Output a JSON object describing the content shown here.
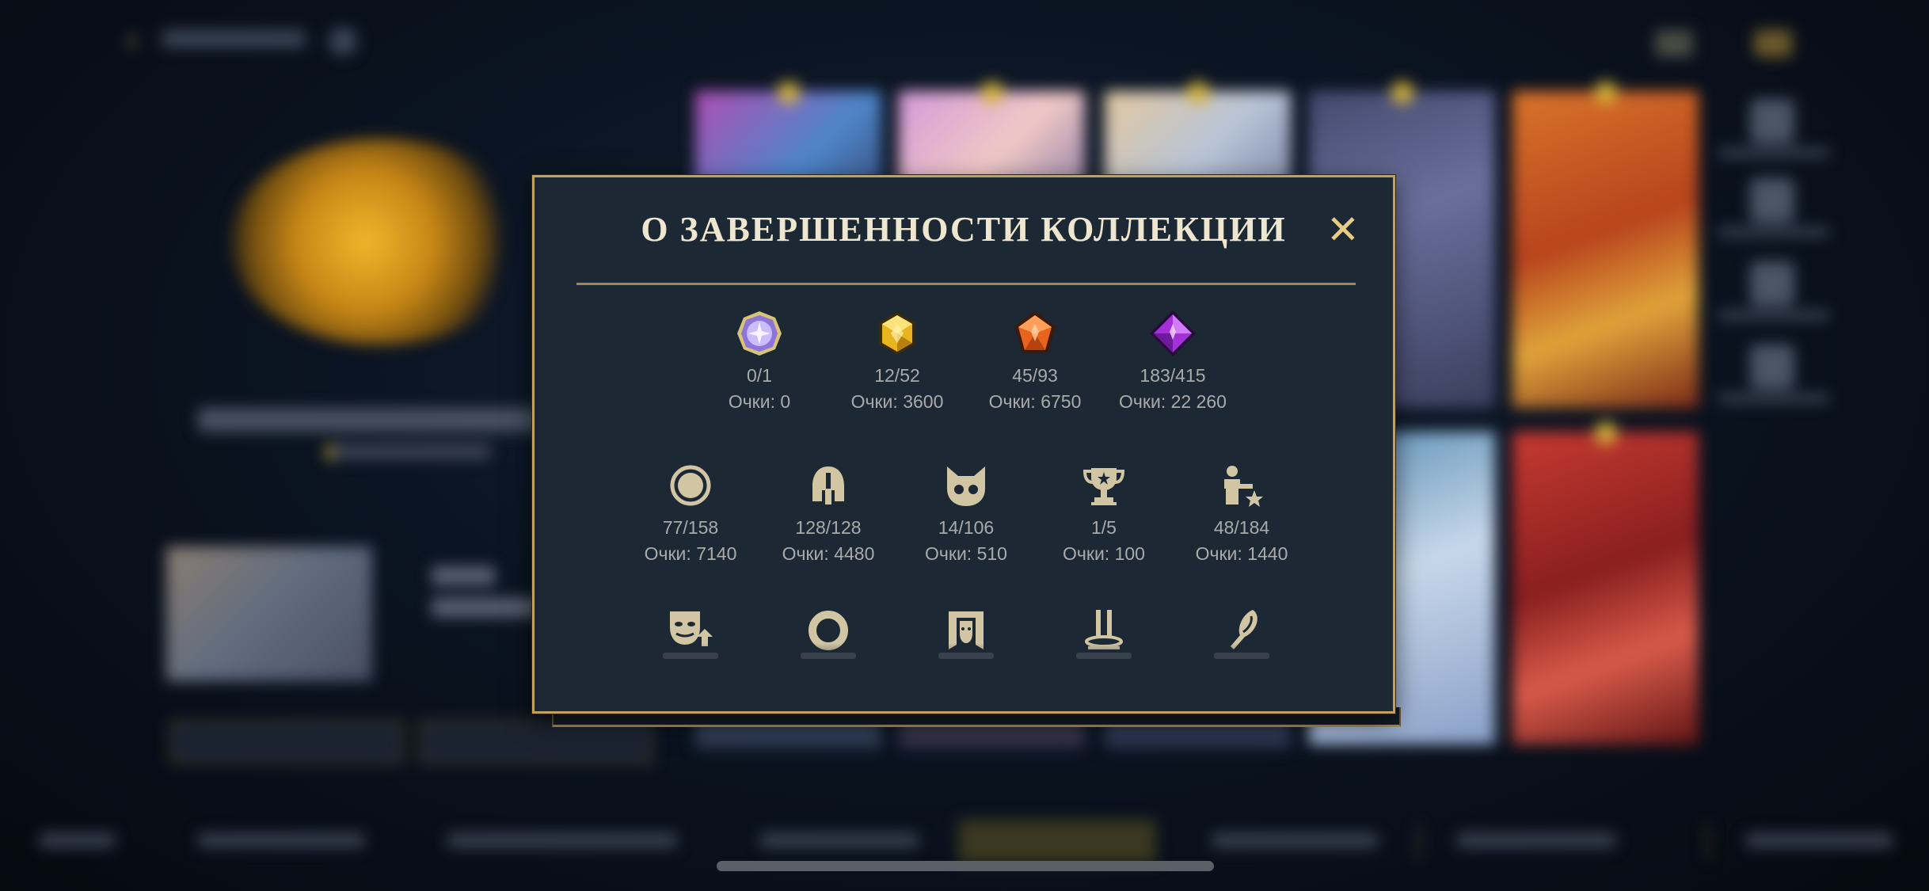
{
  "modal": {
    "title": "О ЗАВЕРШЕННОСТИ КОЛЛЕКЦИИ",
    "close_glyph": "✕"
  },
  "stats_row1": [
    {
      "icon": "ultimate-gem-icon",
      "color": "#b9a8ff",
      "count": "0/1",
      "points": "Очки: 0"
    },
    {
      "icon": "legendary-gem-icon",
      "color": "#e9b51e",
      "count": "12/52",
      "points": "Очки: 3600"
    },
    {
      "icon": "mythic-gem-icon",
      "color": "#e8641c",
      "count": "45/93",
      "points": "Очки: 6750"
    },
    {
      "icon": "epic-gem-icon",
      "color": "#a431d8",
      "count": "183/415",
      "points": "Очки: 22 260"
    }
  ],
  "stats_row2": [
    {
      "icon": "circle-token-icon",
      "count": "77/158",
      "points": "Очки: 7140"
    },
    {
      "icon": "helmet-icon",
      "count": "128/128",
      "points": "Очки: 4480"
    },
    {
      "icon": "cat-face-icon",
      "count": "14/106",
      "points": "Очки: 510"
    },
    {
      "icon": "trophy-icon",
      "count": "1/5",
      "points": "Очки: 100"
    },
    {
      "icon": "person-star-icon",
      "count": "48/184",
      "points": "Очки: 1440"
    }
  ],
  "stats_row3": [
    {
      "icon": "masks-icon"
    },
    {
      "icon": "ring-icon"
    },
    {
      "icon": "banner-face-icon"
    },
    {
      "icon": "pedestal-icon"
    },
    {
      "icon": "feather-icon"
    }
  ],
  "colors": {
    "gold": "#c2a15a",
    "panel": "#1c2833",
    "icon_tan": "#d2c5a4",
    "text_muted": "#a9abab"
  }
}
